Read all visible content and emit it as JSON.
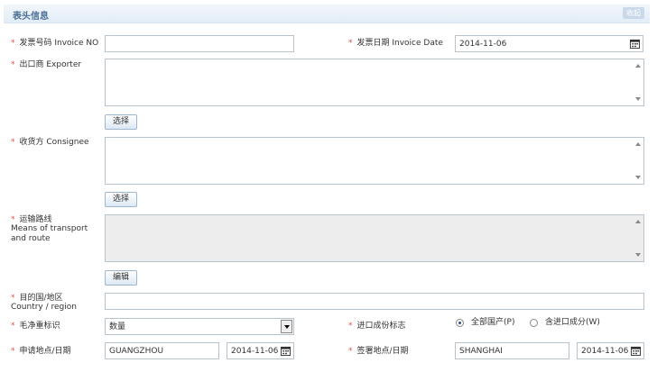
{
  "header": {
    "title": "表头信息",
    "collapse_label": "收起"
  },
  "fields": {
    "invoice_no": {
      "required": "*",
      "label": "发票号码 Invoice NO",
      "value": ""
    },
    "invoice_date": {
      "required": "*",
      "label": "发票日期 Invoice Date",
      "value": "2014-11-06"
    },
    "exporter": {
      "required": "*",
      "label": "出口商 Exporter",
      "value": "",
      "button": "选择"
    },
    "consignee": {
      "required": "*",
      "label": "收货方 Consignee",
      "value": "",
      "button": "选择"
    },
    "transport": {
      "required": "*",
      "label_cn": "运输路线",
      "label_en": "Means of transport and route",
      "value": "",
      "button": "编辑"
    },
    "destination": {
      "required": "*",
      "label_cn": "目的国/地区",
      "label_en": "Country / region",
      "value": ""
    },
    "weight_mark": {
      "required": "*",
      "label": "毛净重标识",
      "selected": "数量"
    },
    "import_content": {
      "required": "*",
      "label": "进口成份标志",
      "options": [
        "全部国产(P)",
        "含进口成分(W)"
      ],
      "selected_index": 0
    },
    "apply_place_date": {
      "required": "*",
      "label": "申请地点/日期",
      "place": "GUANGZHOU",
      "date": "2014-11-06"
    },
    "issue_place_date": {
      "required": "*",
      "label": "签署地点/日期",
      "place": "SHANGHAI",
      "date": "2014-11-06"
    }
  }
}
